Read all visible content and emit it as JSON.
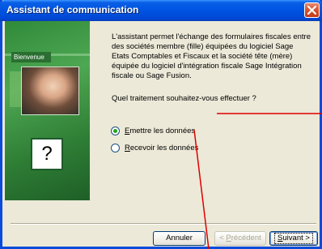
{
  "window": {
    "title": "Assistant de communication"
  },
  "side_panel": {
    "tab_label": "Bienvenue",
    "help_symbol": "?"
  },
  "content": {
    "description": "L'assistant permet l'échange des formulaires fiscales entre des sociétés membre (fille) équipées du logiciel Sage Etats Comptables et Fiscaux et la société tête (mère) équipée du logiciel d'intégration fiscale Sage Intégration fiscale ou Sage Fusion.",
    "question": "Quel traitement souhaitez-vous effectuer ?",
    "options": [
      {
        "first_letter": "E",
        "rest": "mettre les données",
        "selected": true
      },
      {
        "first_letter": "R",
        "rest": "ecevoir les données",
        "selected": false
      }
    ]
  },
  "buttons": {
    "cancel": "Annuler",
    "previous_prefix": "< ",
    "previous_letter": "P",
    "previous_rest": "récédent",
    "next_letter": "S",
    "next_rest": "uivant >"
  },
  "colors": {
    "title_bar": "#0053e1",
    "panel_green": "#2f8a3a",
    "annotation_red": "#e00000"
  }
}
